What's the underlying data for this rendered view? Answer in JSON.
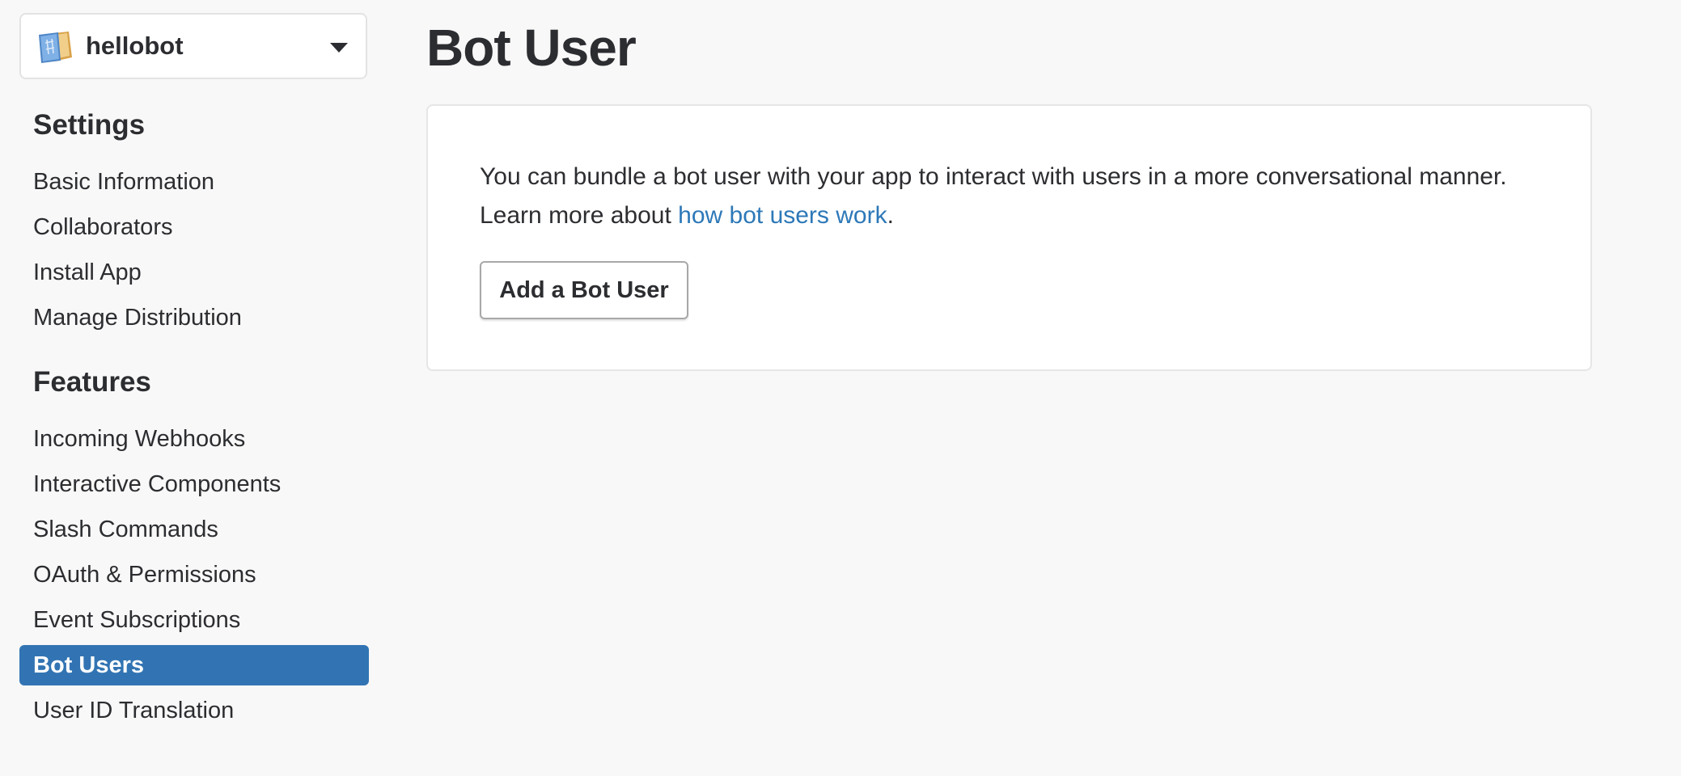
{
  "app_switcher": {
    "name": "hellobot",
    "icon": "app-book-icon",
    "caret_icon": "caret-down-icon"
  },
  "sidebar": {
    "settings_heading": "Settings",
    "settings_items": [
      {
        "label": "Basic Information"
      },
      {
        "label": "Collaborators"
      },
      {
        "label": "Install App"
      },
      {
        "label": "Manage Distribution"
      }
    ],
    "features_heading": "Features",
    "features_items": [
      {
        "label": "Incoming Webhooks"
      },
      {
        "label": "Interactive Components"
      },
      {
        "label": "Slash Commands"
      },
      {
        "label": "OAuth & Permissions"
      },
      {
        "label": "Event Subscriptions"
      },
      {
        "label": "Bot Users",
        "active": true
      },
      {
        "label": "User ID Translation"
      }
    ],
    "active_color": "#3274b3"
  },
  "main": {
    "title": "Bot User",
    "description_before_link": "You can bundle a bot user with your app to interact with users in a more conversational manner. Learn more about ",
    "description_link": "how bot users work",
    "description_after_link": ".",
    "add_button_label": "Add a Bot User",
    "link_color": "#2d78b8"
  }
}
